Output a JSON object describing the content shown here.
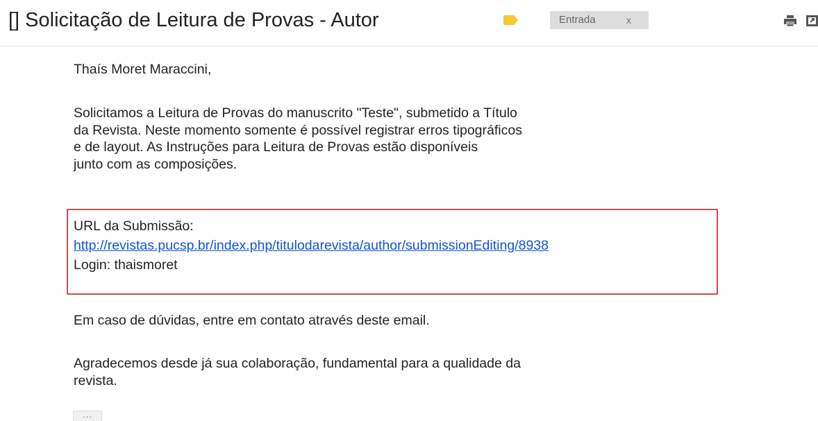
{
  "header": {
    "subject": "[] Solicitação de Leitura de Provas - Autor",
    "label_marker_color": "#f6c633",
    "label_chip": "Entrada",
    "label_chip_remove": "x",
    "icons": [
      "print-icon",
      "new-window-icon"
    ]
  },
  "message": {
    "greeting": "Thaís Moret Maraccini,",
    "paragraph1": [
      "Solicitamos a Leitura de Provas do manuscrito \"Teste\", submetido a Título",
      "da Revista. Neste momento somente é possível registrar erros tipográficos",
      "e de layout. As Instruções para Leitura de Provas estão disponíveis",
      "junto com as composições."
    ],
    "submission_url_label": "URL da Submissão:",
    "submission_url": "http://revistas.pucsp.br/index.php/titulodarevista/author/submissionEditing/8938",
    "login_line": "Login: thaismoret",
    "highlight_box_color": "#c0504d",
    "paragraph2": "Em caso de dúvidas, entre em contato através deste email.",
    "paragraph3": [
      "Agradecemos desde já sua colaboração, fundamental para a qualidade da",
      "revista."
    ],
    "trimmed_content_button": "..."
  }
}
